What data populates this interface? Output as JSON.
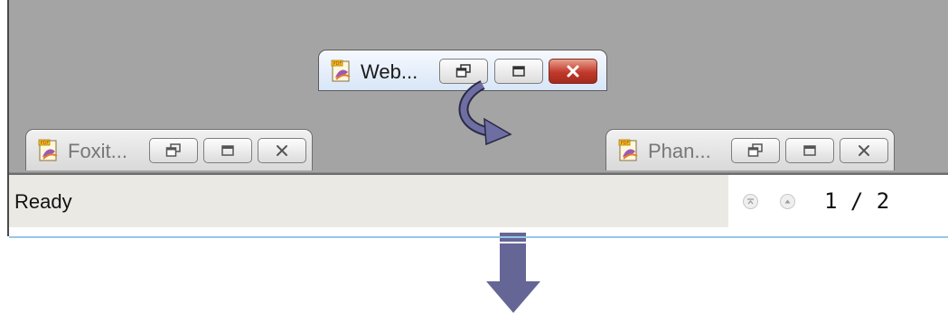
{
  "windows": [
    {
      "title": "Web...",
      "close_style": "red"
    },
    {
      "title": "Foxit...",
      "close_style": "normal"
    },
    {
      "title": "Phan...",
      "close_style": "normal"
    }
  ],
  "status_bar": {
    "text": "Ready",
    "page_indicator": "1 / 2"
  },
  "icons": {
    "window_icon": "pdf-document-icon",
    "restore": "restore-icon",
    "maximize": "maximize-icon",
    "close": "close-icon",
    "first_page": "first-page-icon",
    "previous_page": "previous-page-icon",
    "curved_arrow": "curved-arrow-icon",
    "down_arrow": "down-arrow-icon"
  },
  "colors": {
    "mdi_background": "#a4a4a4",
    "status_bar": "#ebe9e4",
    "close_active": "#c0392b",
    "annotation_arrow": "#656596"
  }
}
